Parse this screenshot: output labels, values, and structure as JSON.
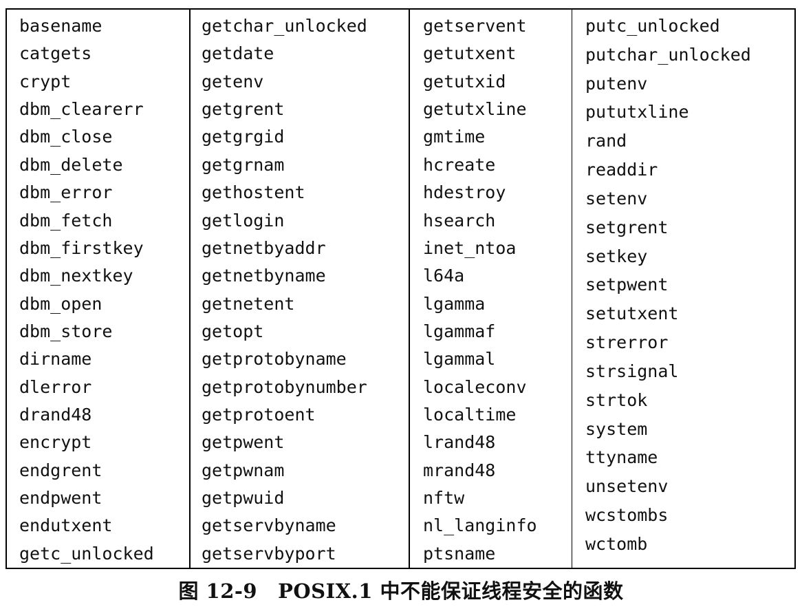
{
  "table": {
    "columns": [
      [
        "basename",
        "catgets",
        "crypt",
        "dbm_clearerr",
        "dbm_close",
        "dbm_delete",
        "dbm_error",
        "dbm_fetch",
        "dbm_firstkey",
        "dbm_nextkey",
        "dbm_open",
        "dbm_store",
        "dirname",
        "dlerror",
        "drand48",
        "encrypt",
        "endgrent",
        "endpwent",
        "endutxent",
        "getc_unlocked"
      ],
      [
        "getchar_unlocked",
        "getdate",
        "getenv",
        "getgrent",
        "getgrgid",
        "getgrnam",
        "gethostent",
        "getlogin",
        "getnetbyaddr",
        "getnetbyname",
        "getnetent",
        "getopt",
        "getprotobyname",
        "getprotobynumber",
        "getprotoent",
        "getpwent",
        "getpwnam",
        "getpwuid",
        "getservbyname",
        "getservbyport"
      ],
      [
        "getservent",
        "getutxent",
        "getutxid",
        "getutxline",
        "gmtime",
        "hcreate",
        "hdestroy",
        "hsearch",
        "inet_ntoa",
        "l64a",
        "lgamma",
        "lgammaf",
        "lgammal",
        "localeconv",
        "localtime",
        "lrand48",
        "mrand48",
        "nftw",
        "nl_langinfo",
        "ptsname"
      ],
      [
        "putc_unlocked",
        "putchar_unlocked",
        "putenv",
        "pututxline",
        "rand",
        "readdir",
        "setenv",
        "setgrent",
        "setkey",
        "setpwent",
        "setutxent",
        "strerror",
        "strsignal",
        "strtok",
        "system",
        "ttyname",
        "unsetenv",
        "wcstombs",
        "wctomb",
        ""
      ]
    ]
  },
  "caption": {
    "number": "图 12-9",
    "text": "POSIX.1 中不能保证线程安全的函数"
  }
}
